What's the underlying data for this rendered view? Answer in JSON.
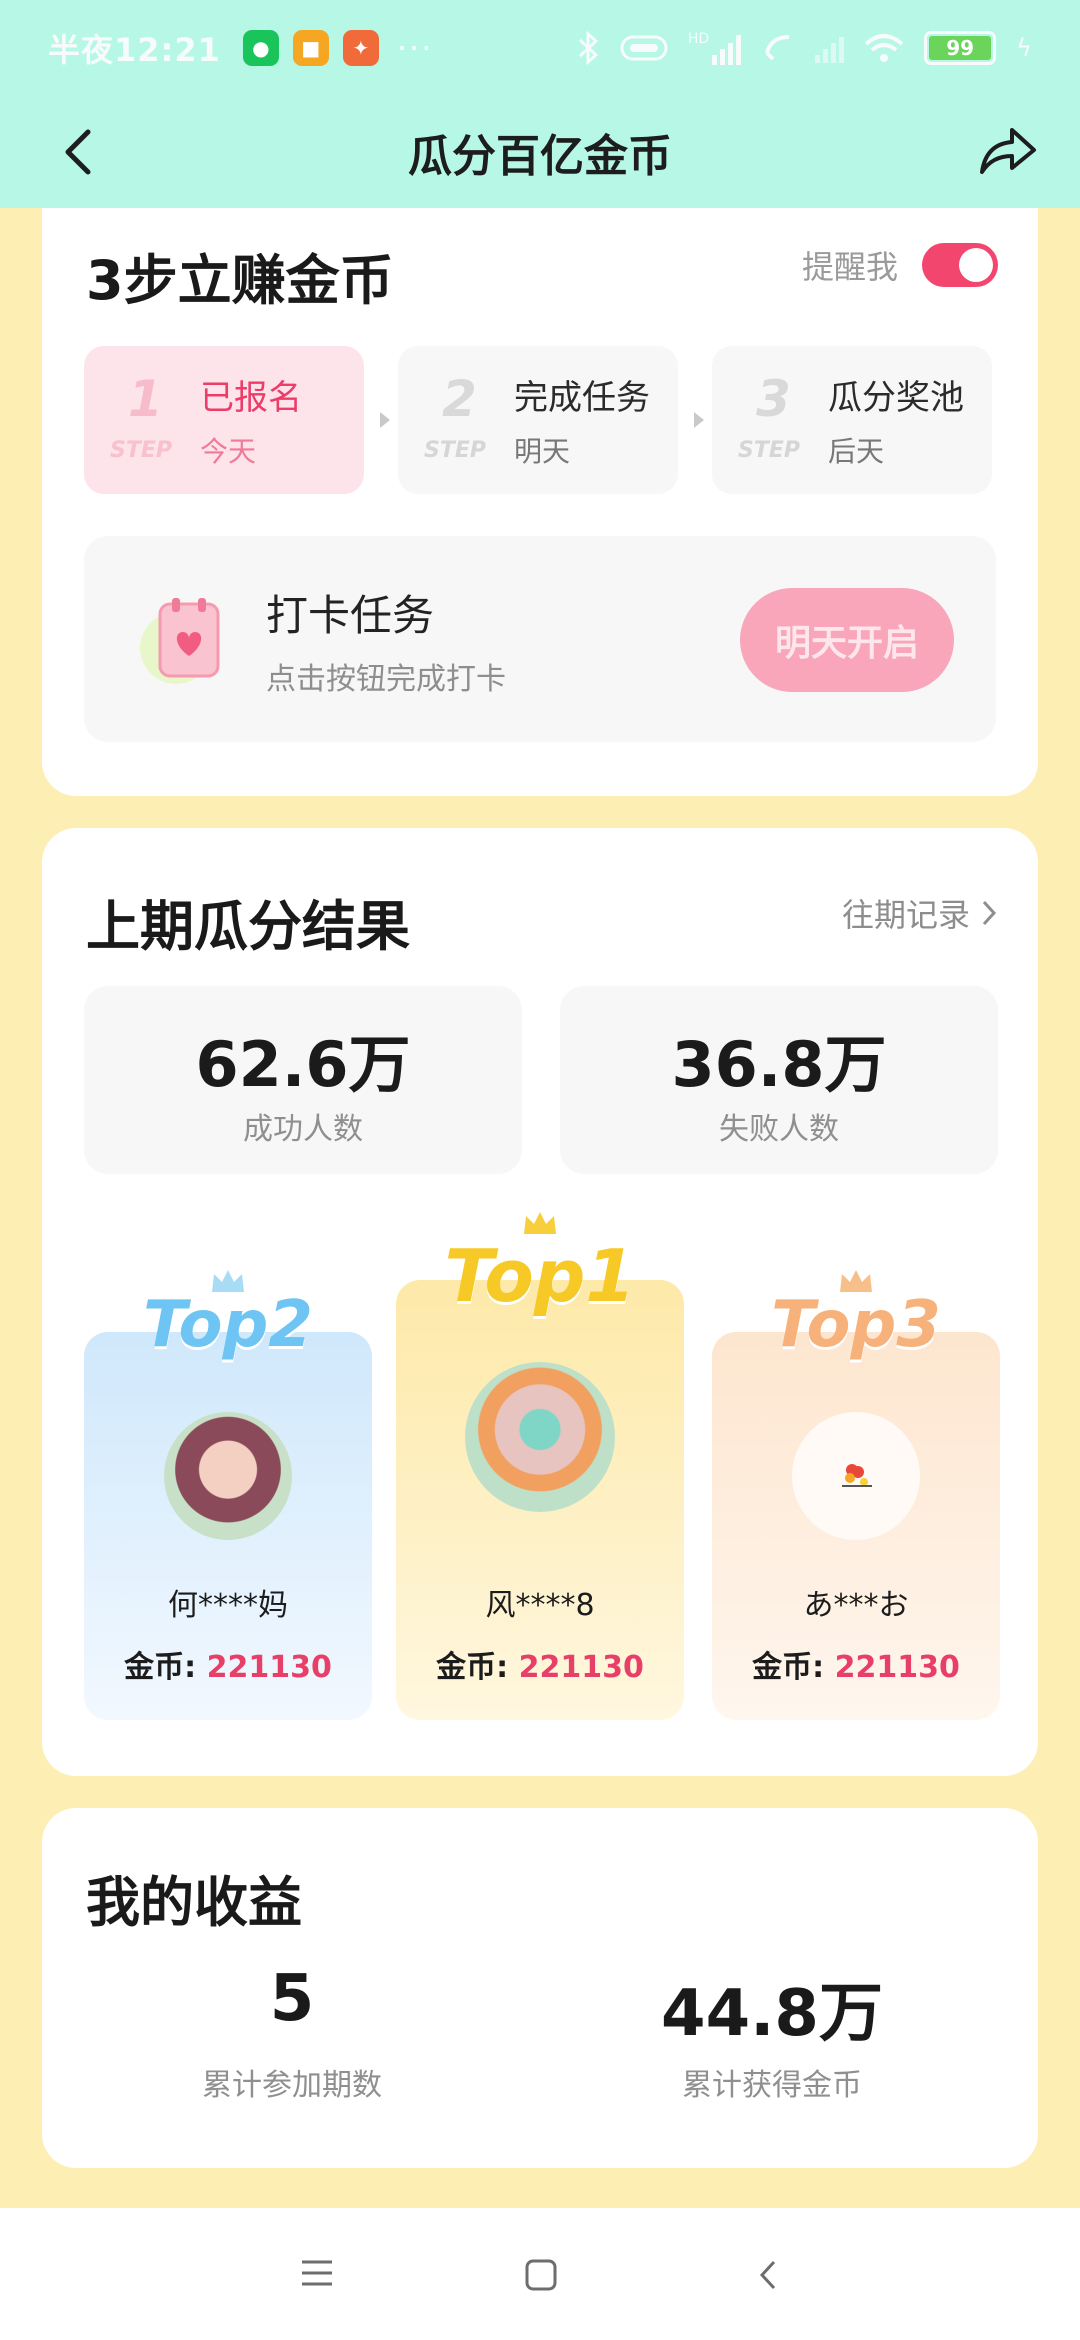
{
  "status_bar": {
    "time": "半夜12:21",
    "dots": "···",
    "battery": "99",
    "signal": "HD"
  },
  "nav": {
    "title": "瓜分百亿金币"
  },
  "steps_card": {
    "title": "3步立赚金币",
    "remind_label": "提醒我",
    "remind_on": true,
    "steps": [
      {
        "num": "1",
        "step": "STEP",
        "name": "已报名",
        "when": "今天"
      },
      {
        "num": "2",
        "step": "STEP",
        "name": "完成任务",
        "when": "明天"
      },
      {
        "num": "3",
        "step": "STEP",
        "name": "瓜分奖池",
        "when": "后天"
      }
    ],
    "task": {
      "title": "打卡任务",
      "subtitle": "点击按钮完成打卡",
      "button": "明天开启"
    }
  },
  "results_card": {
    "title": "上期瓜分结果",
    "history_link": "往期记录",
    "success": {
      "value": "62.6万",
      "label": "成功人数"
    },
    "fail": {
      "value": "36.8万",
      "label": "失败人数"
    },
    "top": [
      {
        "rank_label": "Top2",
        "name": "何****妈",
        "coins_label": "金币: ",
        "coins": "221130"
      },
      {
        "rank_label": "Top1",
        "name": "风****8",
        "coins_label": "金币: ",
        "coins": "221130"
      },
      {
        "rank_label": "Top3",
        "name": "あ***お",
        "coins_label": "金币: ",
        "coins": "221130"
      }
    ]
  },
  "earnings_card": {
    "title": "我的收益",
    "periods": {
      "value": "5",
      "label": "累计参加期数"
    },
    "coins": {
      "value": "44.8万",
      "label": "累计获得金币"
    }
  },
  "colors": {
    "header_bg": "#b6f7e6",
    "page_bg": "#fdeeb3",
    "accent_pink": "#f2466e",
    "coin_red": "#e83f69"
  }
}
